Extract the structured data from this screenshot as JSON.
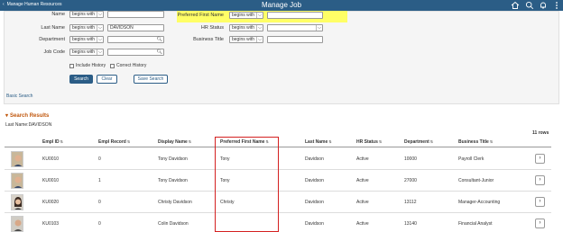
{
  "header": {
    "back_label": "Manage Human Resources",
    "title": "Manage Job",
    "icons": [
      "home-icon",
      "search-icon",
      "notification-icon",
      "more-icon"
    ]
  },
  "search": {
    "fields_left": [
      {
        "label": "Name",
        "operator": "begins with",
        "value": ""
      },
      {
        "label": "Last Name",
        "operator": "begins with",
        "value": "DAVIDSON"
      },
      {
        "label": "Department",
        "operator": "begins with",
        "value": ""
      },
      {
        "label": "Job Code",
        "operator": "begins with",
        "value": ""
      }
    ],
    "fields_right": [
      {
        "label": "Preferred First Name",
        "operator": "begins with",
        "value": ""
      },
      {
        "label": "HR Status",
        "operator": "begins with",
        "value": ""
      },
      {
        "label": "Business Title",
        "operator": "begins with",
        "value": ""
      }
    ],
    "include_history_label": "Include History",
    "correct_history_label": "Correct History",
    "search_button": "Search",
    "clear_button": "Clear",
    "save_search_button": "Save Search",
    "basic_search_link": "Basic Search"
  },
  "results": {
    "title": "Search Results",
    "criteria": "Last Name:DAVIDSON",
    "row_count": "11 rows",
    "columns": [
      "Empl ID",
      "Empl Record",
      "Display Name",
      "Preferred First Name",
      "Last Name",
      "HR Status",
      "Department",
      "Business Title"
    ],
    "rows": [
      {
        "empl_id": "KU0010",
        "empl_record": "0",
        "display_name": "Tony Davidson",
        "preferred_first_name": "Tony",
        "last_name": "Davidson",
        "hr_status": "Active",
        "department": "10000",
        "business_title": "Payroll Clerk"
      },
      {
        "empl_id": "KU0010",
        "empl_record": "1",
        "display_name": "Tony Davidson",
        "preferred_first_name": "Tony",
        "last_name": "Davidson",
        "hr_status": "Active",
        "department": "27000",
        "business_title": "Consultant-Junior"
      },
      {
        "empl_id": "KU0020",
        "empl_record": "0",
        "display_name": "Christy Davidson",
        "preferred_first_name": "Christy",
        "last_name": "Davidson",
        "hr_status": "Active",
        "department": "13112",
        "business_title": "Manager-Accounting"
      },
      {
        "empl_id": "KU0103",
        "empl_record": "0",
        "display_name": "Colin Davidson",
        "preferred_first_name": "",
        "last_name": "Davidson",
        "hr_status": "Active",
        "department": "13140",
        "business_title": "Financial Analyst"
      }
    ]
  },
  "colors": {
    "header_bg": "#2b5d86",
    "highlight": "#ffff66",
    "section_title": "#c0570d",
    "annotation_box": "#d42020"
  }
}
